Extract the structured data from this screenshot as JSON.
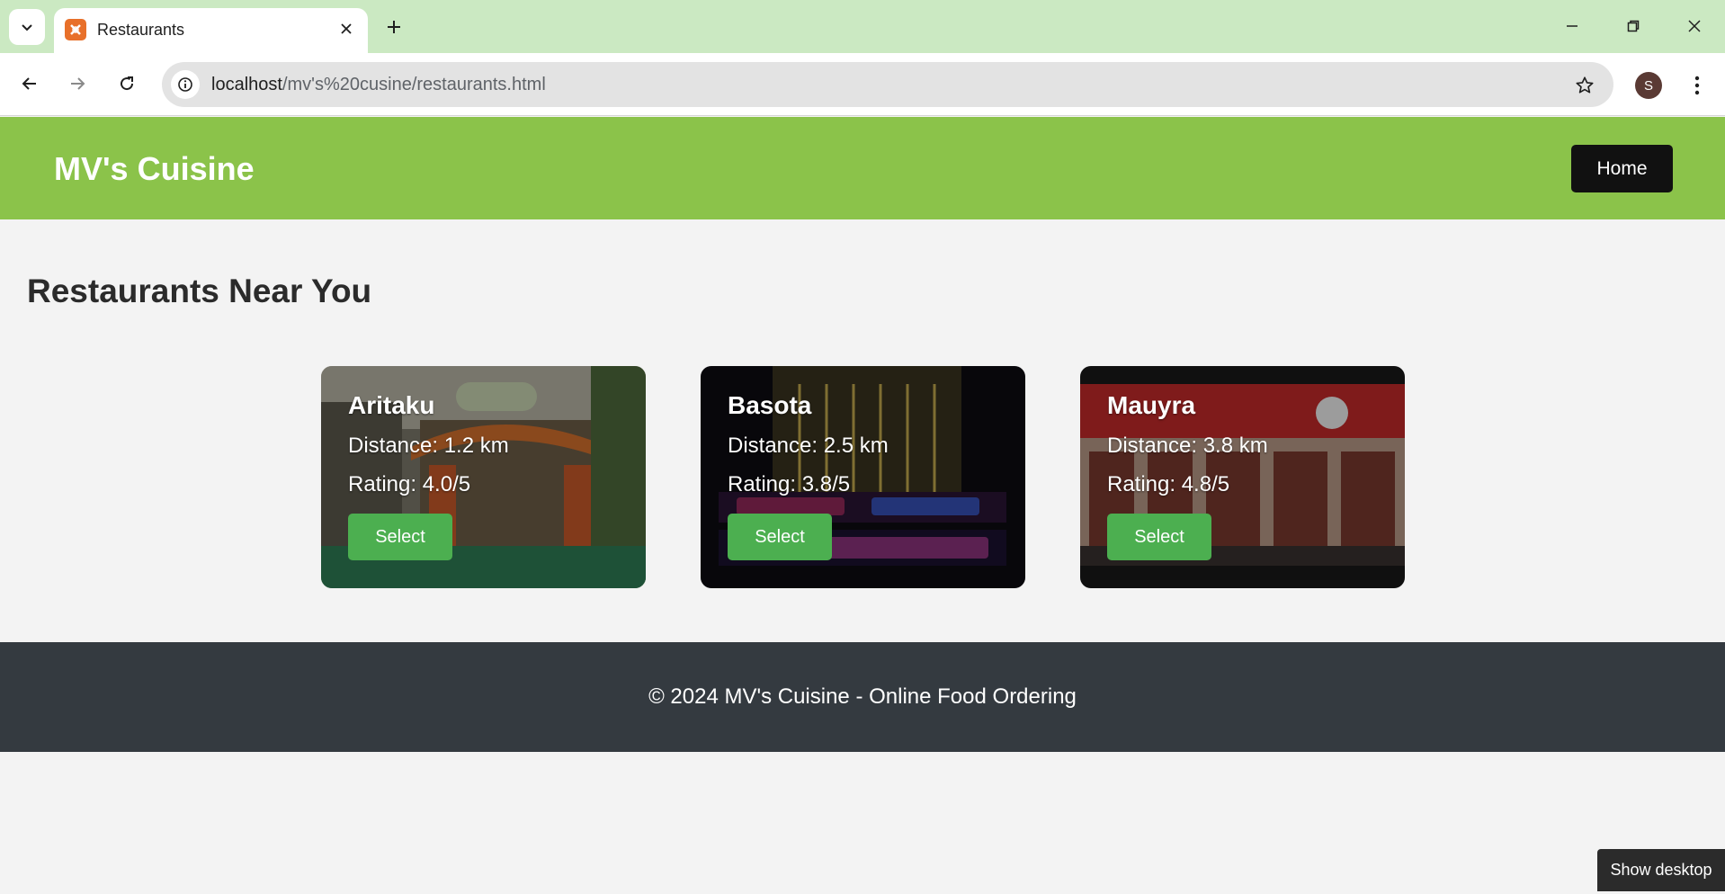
{
  "browser": {
    "tab_title": "Restaurants",
    "url_host": "localhost",
    "url_path": "/mv's%20cusine/restaurants.html",
    "profile_initial": "S"
  },
  "site": {
    "brand": "MV's Cuisine",
    "nav_home": "Home",
    "section_title": "Restaurants Near You",
    "footer": "© 2024 MV's Cuisine - Online Food Ordering"
  },
  "restaurants": [
    {
      "name": "Aritaku",
      "distance": "Distance: 1.2 km",
      "rating": "Rating: 4.0/5",
      "button": "Select"
    },
    {
      "name": "Basota",
      "distance": "Distance: 2.5 km",
      "rating": "Rating: 3.8/5",
      "button": "Select"
    },
    {
      "name": "Mauyra",
      "distance": "Distance: 3.8 km",
      "rating": "Rating: 4.8/5",
      "button": "Select"
    }
  ],
  "taskbar": {
    "show_desktop": "Show desktop"
  },
  "colors": {
    "header_green": "#8bc34a",
    "select_green": "#4caf50",
    "footer_bg": "#343a40",
    "tabstrip_bg": "#cbe9c2"
  },
  "icons": [
    "tab-search-icon",
    "favicon-icon",
    "close-icon",
    "plus-icon",
    "minimize-icon",
    "restore-icon",
    "back-arrow-icon",
    "forward-arrow-icon",
    "reload-icon",
    "info-icon",
    "star-icon",
    "kebab-menu-icon"
  ]
}
